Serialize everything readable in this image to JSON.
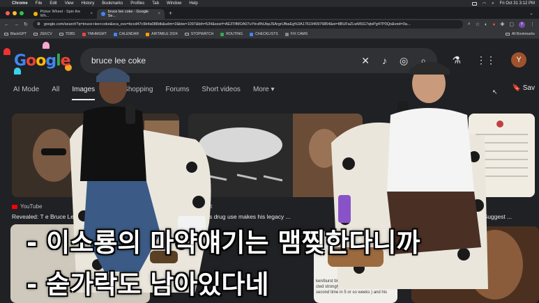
{
  "menubar": {
    "app": "Chrome",
    "items": [
      "File",
      "Edit",
      "View",
      "History",
      "Bookmarks",
      "Profiles",
      "Tab",
      "Window",
      "Help"
    ],
    "datetime": "Fri Oct 31  3:12 PM"
  },
  "tabs": [
    {
      "label": "Picker Wheel - Spin the Wh...",
      "active": false
    },
    {
      "label": "bruce lee coke - Google Se...",
      "active": true
    }
  ],
  "toolbar": {
    "url": "google.com/search?q=bruce+lee+coke&sca_esv=bccd47c9b4a088db&udm=2&biw=1097&bih=534&sxsrf=AE3TifMOA07uYtrufIhUbpJSArgrUfbaEg%3A1761940976854&ei=8BUFaZLwMSG7qtsPg47P0Qo&ved=0a...",
    "profile_initial": "Y"
  },
  "bookmarks": {
    "items": [
      "BlackGPT",
      "ZEKCV",
      "TDBS",
      "YMHMGMT",
      "CALENDAR",
      "AIRTABLE 2024",
      "STOPWATCH",
      "ROUTING",
      "CHECKLISTS",
      "FIX CAMS"
    ],
    "all_label": "All Bookmarks"
  },
  "google": {
    "logo": "Google",
    "query": "bruce lee coke",
    "user_initial": "Y",
    "tabs": [
      "AI Mode",
      "All",
      "Images",
      "s",
      "Shopping",
      "Forums",
      "Short videos",
      "More"
    ],
    "active_tab": "Images",
    "saved_label": "Sav"
  },
  "results": [
    {
      "source": "YouTube",
      "caption": "Revealed: T   e Bruce Lee"
    },
    {
      "source": "eddit",
      "caption": "s   L's drug use makes his legacy ..."
    },
    {
      "source": "",
      "caption": "ters Suggest ..."
    }
  ],
  "bottom_text": [
    "ken/burst blood vessels. His body",
    "cted strongly to using coke (the",
    "second time in 5 or so weeks ) and his"
  ],
  "subtitles": {
    "line1": "- 이소룡의 마약얘기는 맴찢한다니까",
    "line2": "- 숟가락도 남아있다네"
  },
  "colors": {
    "menubar": "#2a2b2e",
    "tab_active": "#35363a",
    "google_bg": "#202124",
    "searchbox": "#303134"
  }
}
